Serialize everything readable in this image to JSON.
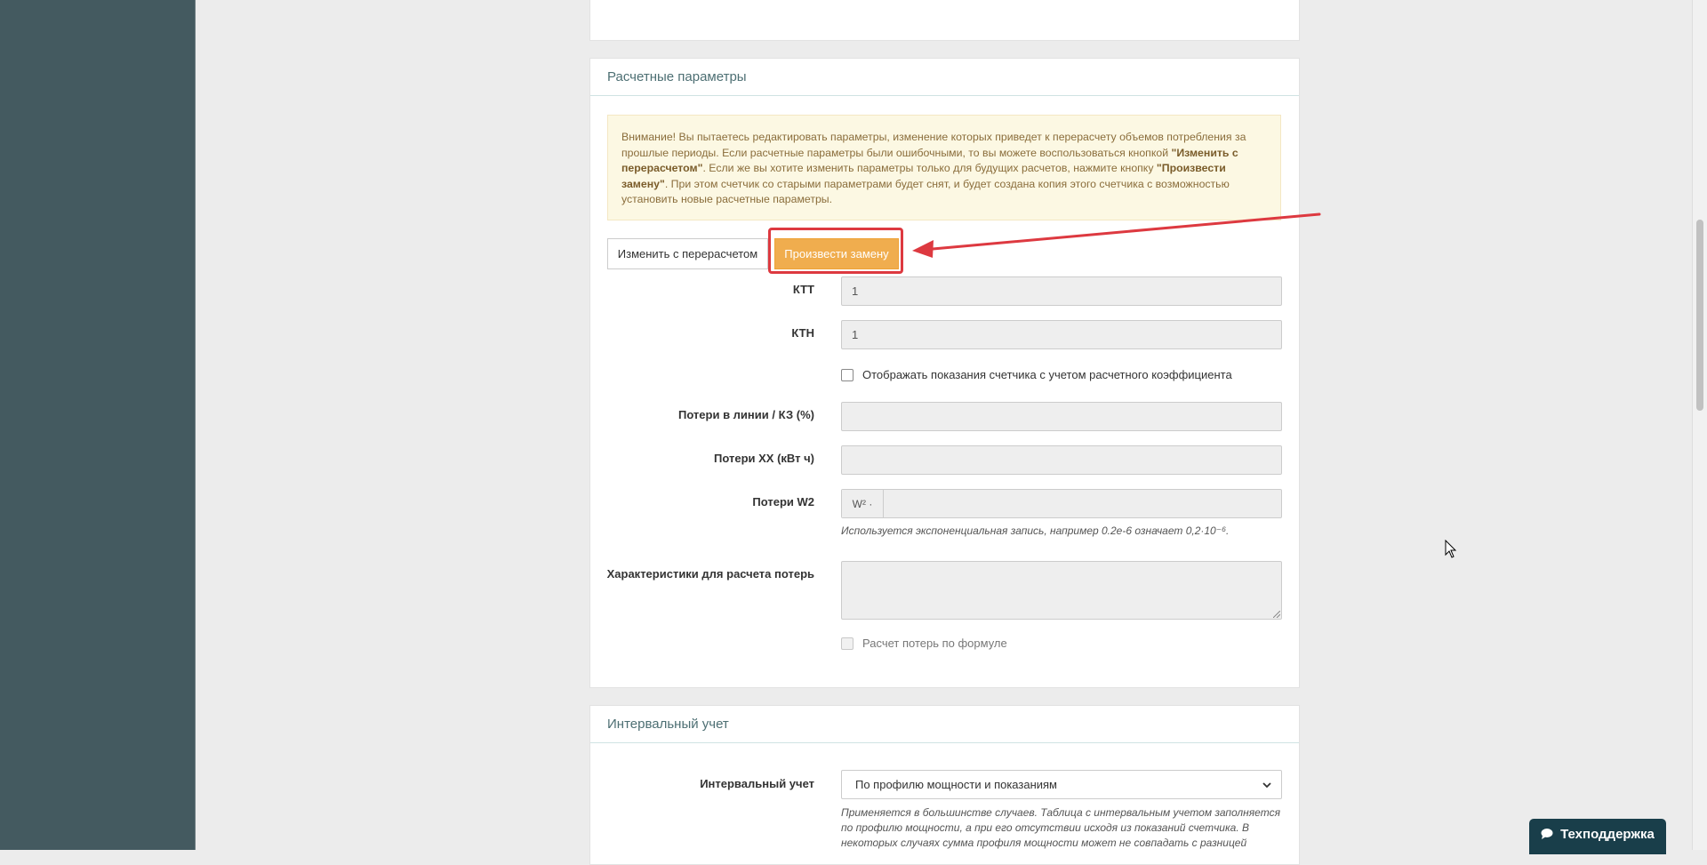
{
  "panel_calc": {
    "title": "Расчетные параметры",
    "alert": {
      "t1": "Внимание! Вы пытаетесь редактировать параметры, изменение которых приведет к перерасчету объемов потребления за прошлые периоды. Если расчетные параметры были ошибочными, то вы можете воспользоваться кнопкой ",
      "b1": "\"Изменить с перерасчетом\"",
      "t2": ". Если же вы хотите изменить параметры только для будущих расчетов, нажмите кнопку ",
      "b2": "\"Произвести замену\"",
      "t3": ". При этом счетчик со старыми параметрами будет снят, и будет создана копия этого счетчика с возможностью установить новые расчетные параметры."
    },
    "btn_recalc": "Изменить с перерасчетом",
    "btn_replace": "Произвести замену",
    "ktt_label": "КТТ",
    "ktt_value": "1",
    "ktn_label": "КТН",
    "ktn_value": "1",
    "show_coef_label": "Отображать показания счетчика с учетом расчетного коэффициента",
    "loss_line_label": "Потери в линии / КЗ (%)",
    "loss_xx_label": "Потери XX (кВт ч)",
    "loss_w2_label": "Потери W2",
    "w2_addon": "W² ·",
    "w2_help": "Используется экспоненциальная запись, например 0.2e-6 означает 0,2·10⁻⁶.",
    "loss_char_label": "Характеристики для расчета потерь",
    "formula_label": "Расчет потерь по формуле"
  },
  "panel_interval": {
    "title": "Интервальный учет",
    "label": "Интервальный учет",
    "select_value": "По профилю мощности и показаниям",
    "help": "Применяется в большинстве случаев. Таблица с интервальным учетом заполняется по профилю мощности, а при его отсутствии исходя из показаний счетчика. В некоторых случаях сумма профиля мощности может не совпадать с разницей"
  },
  "support_label": "Техподдержка",
  "colors": {
    "sidebar": "#445a60",
    "warning_button": "#f0ad4e",
    "highlight": "#dd3940",
    "alert_bg": "#fcf8e3",
    "support_bg": "#193e4a"
  },
  "icons": [
    "chat-icon",
    "chevron-down-icon",
    "mouse-cursor-icon",
    "annotation-arrow"
  ]
}
